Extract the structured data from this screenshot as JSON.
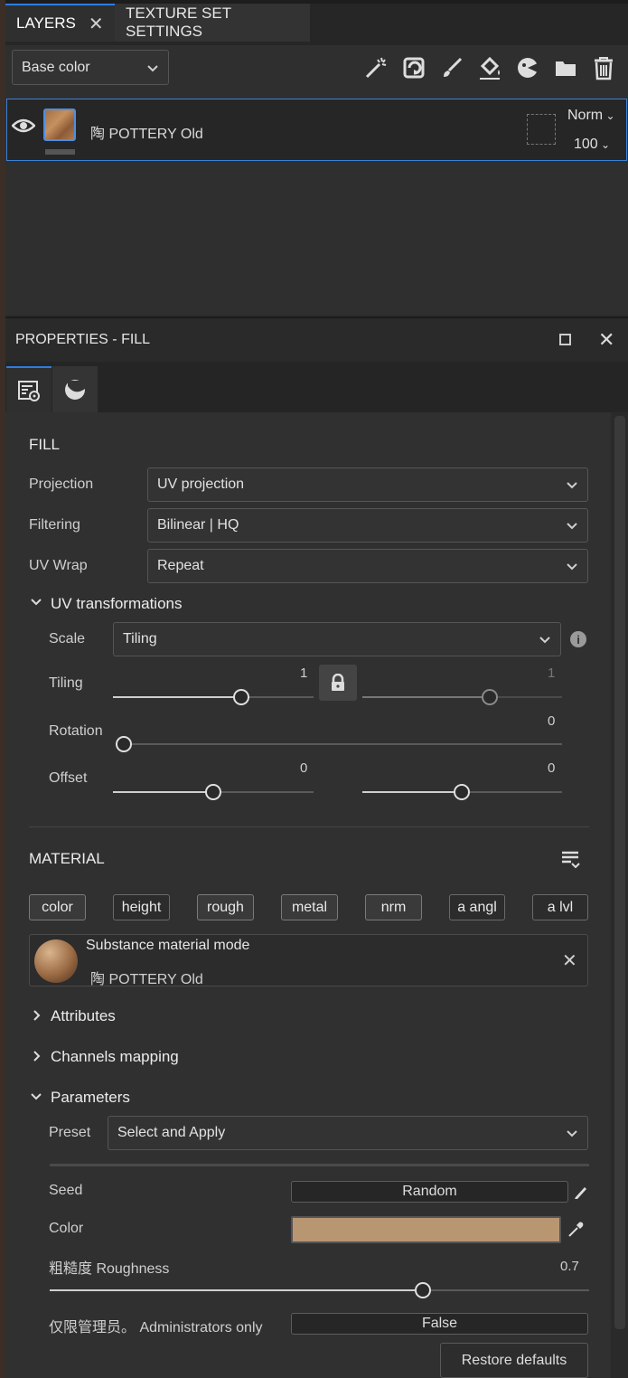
{
  "tabs": [
    {
      "label": "LAYERS"
    },
    {
      "label": "TEXTURE SET SETTINGS"
    }
  ],
  "channel_select": {
    "value": "Base color"
  },
  "layer": {
    "name": "陶 POTTERY Old",
    "blend_mode": "Norm",
    "opacity": "100"
  },
  "properties": {
    "title": "PROPERTIES - FILL",
    "fill_title": "FILL",
    "projection": {
      "label": "Projection",
      "value": "UV projection"
    },
    "filtering": {
      "label": "Filtering",
      "value": "Bilinear | HQ"
    },
    "uv_wrap": {
      "label": "UV Wrap",
      "value": "Repeat"
    },
    "uv_transformations": {
      "title": "UV transformations",
      "scale": {
        "label": "Scale",
        "value": "Tiling"
      },
      "tiling": {
        "label": "Tiling",
        "value_u": "1",
        "value_v": "1"
      },
      "rotation": {
        "label": "Rotation",
        "value": "0"
      },
      "offset": {
        "label": "Offset",
        "value_u": "0",
        "value_v": "0"
      }
    },
    "material": {
      "title": "MATERIAL",
      "chips": [
        {
          "label": "color",
          "active": true
        },
        {
          "label": "height",
          "active": false
        },
        {
          "label": "rough",
          "active": true
        },
        {
          "label": "metal",
          "active": true
        },
        {
          "label": "nrm",
          "active": true
        },
        {
          "label": "a angl",
          "active": false
        },
        {
          "label": "a lvl",
          "active": false
        }
      ],
      "mode_title": "Substance material mode",
      "mode_name": "陶 POTTERY Old"
    },
    "attributes_title": "Attributes",
    "channels_mapping_title": "Channels mapping",
    "parameters": {
      "title": "Parameters",
      "preset": {
        "label": "Preset",
        "value": "Select and Apply"
      },
      "seed": {
        "label": "Seed",
        "value": "Random"
      },
      "color": {
        "label": "Color",
        "swatch": "#b99672"
      },
      "roughness": {
        "label": "粗糙度 Roughness",
        "value": "0.7"
      },
      "admin": {
        "label": "仅限管理员。 Administrators only",
        "value": "False"
      },
      "restore_label": "Restore defaults"
    }
  },
  "colors": {
    "accent": "#2e7de1",
    "panel": "#303030"
  }
}
